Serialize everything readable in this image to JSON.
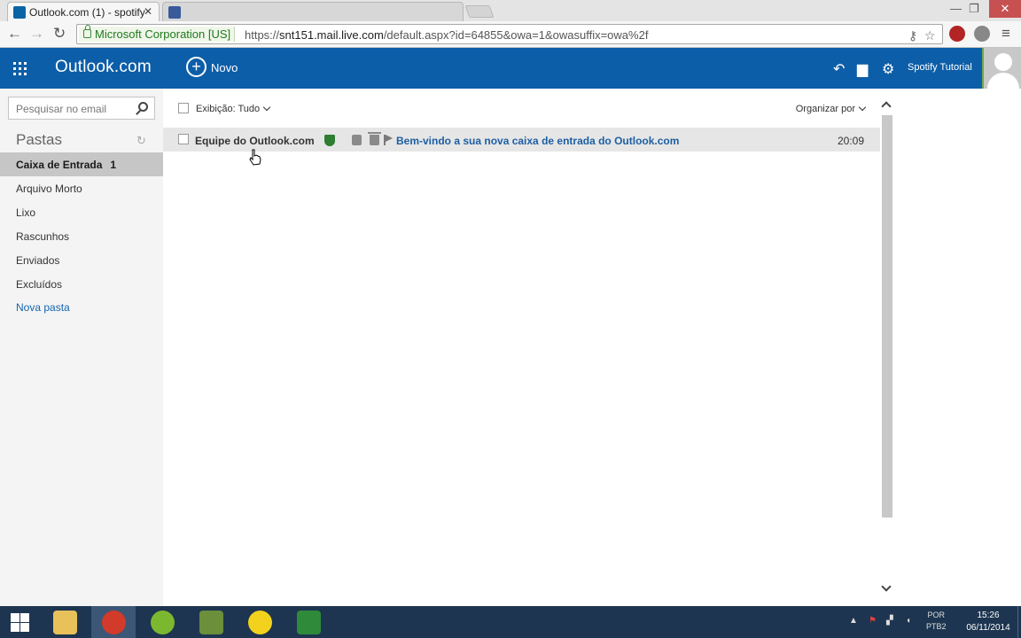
{
  "browser": {
    "active_tab_title": "Outlook.com (1) - spotify",
    "inactive_tab_title": "",
    "ev_cert": "Microsoft Corporation [US]",
    "url_scheme": "https://",
    "url_host": "snt151.mail.live.com",
    "url_path": "/default.aspx?id=64855&owa=1&owasuffix=owa%2f"
  },
  "header": {
    "brand": "Outlook.com",
    "new_label": "Novo",
    "user_name": "Spotify Tutorial"
  },
  "sidebar": {
    "search_placeholder": "Pesquisar no email",
    "folders_title": "Pastas",
    "folders": [
      {
        "label": "Caixa de Entrada",
        "count": "1",
        "selected": true
      },
      {
        "label": "Arquivo Morto"
      },
      {
        "label": "Lixo"
      },
      {
        "label": "Rascunhos"
      },
      {
        "label": "Enviados"
      },
      {
        "label": "Excluídos"
      }
    ],
    "new_folder": "Nova pasta"
  },
  "list": {
    "filter_label": "Exibição: Tudo",
    "sort_label": "Organizar por",
    "messages": [
      {
        "sender": "Equipe do Outlook.com",
        "subject": "Bem-vindo a sua nova caixa de entrada do Outlook.com",
        "time": "20:09",
        "unread": true
      }
    ]
  },
  "taskbar": {
    "apps": [
      "start",
      "file-explorer",
      "chrome",
      "spotify",
      "app-green",
      "cyberghost",
      "camtasia"
    ],
    "lang_line1": "POR",
    "lang_line2": "PTB2",
    "time": "15:26",
    "date": "06/11/2014"
  },
  "colors": {
    "outlook_blue": "#0d5ea8",
    "selected_folder": "#c6c6c6",
    "subject_link": "#1d5fa3",
    "taskbar": "#1d3550"
  }
}
